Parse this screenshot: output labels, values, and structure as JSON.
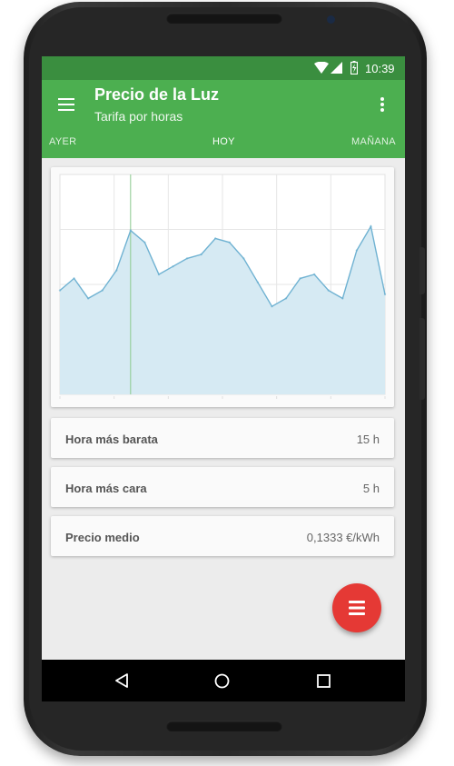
{
  "status_bar": {
    "time": "10:39",
    "icons": [
      "wifi-icon",
      "signal-icon",
      "battery-icon"
    ]
  },
  "app_bar": {
    "title": "Precio de la Luz",
    "subtitle": "Tarifa por horas",
    "menu_icon": "hamburger-menu-icon",
    "overflow_icon": "more-vert-icon"
  },
  "tabs": [
    {
      "label": "AYER",
      "selected": false
    },
    {
      "label": "HOY",
      "selected": true
    },
    {
      "label": "MAÑANA",
      "selected": false
    }
  ],
  "chart_data": {
    "type": "area",
    "title": "",
    "xlabel": "",
    "ylabel": "",
    "x": [
      0,
      1,
      2,
      3,
      4,
      5,
      6,
      7,
      8,
      9,
      10,
      11,
      12,
      13,
      14,
      15,
      16,
      17,
      18,
      19,
      20,
      21,
      22,
      23
    ],
    "series": [
      {
        "values": [
          0.131,
          0.134,
          0.129,
          0.131,
          0.136,
          0.146,
          0.143,
          0.135,
          0.137,
          0.139,
          0.14,
          0.144,
          0.143,
          0.139,
          0.133,
          0.127,
          0.129,
          0.134,
          0.135,
          0.131,
          0.129,
          0.141,
          0.147,
          0.13
        ]
      }
    ],
    "ylim": [
      0.105,
      0.16
    ],
    "highlight_x": 5,
    "grid": true,
    "fill_color": "#d6eaf3",
    "line_color": "#6fb2d2"
  },
  "stats": [
    {
      "label": "Hora más barata",
      "value": "15 h"
    },
    {
      "label": "Hora más cara",
      "value": "5 h"
    },
    {
      "label": "Precio medio",
      "value": "0,1333 €/kWh"
    }
  ],
  "fab": {
    "icon": "list-icon",
    "color": "#e53935"
  },
  "nav_bar": {
    "icons": [
      "back-icon",
      "home-icon",
      "recents-icon"
    ]
  },
  "colors": {
    "primary": "#4caf50",
    "primary_dark": "#3a8e3f",
    "accent": "#e53935"
  }
}
